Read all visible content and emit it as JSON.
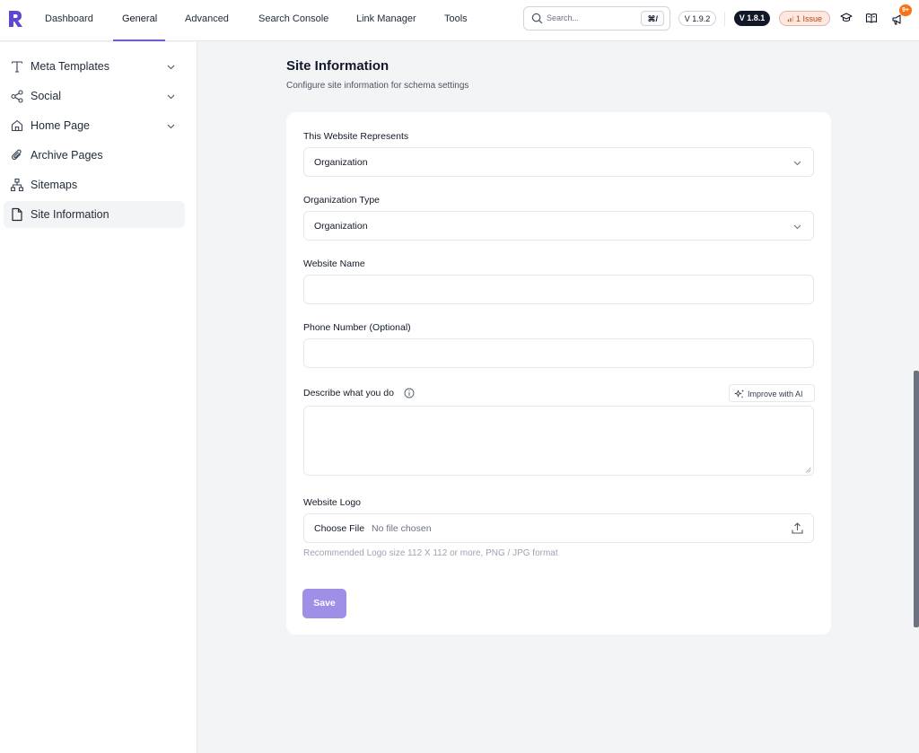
{
  "topnav": {
    "tabs": [
      {
        "label": "Dashboard"
      },
      {
        "label": "General",
        "active": true
      },
      {
        "label": "Advanced"
      },
      {
        "label": "Search Console"
      },
      {
        "label": "Link Manager"
      },
      {
        "label": "Tools"
      }
    ],
    "search": {
      "placeholder": "Search...",
      "shortcut": "⌘/"
    },
    "version_current": "V 1.9.2",
    "version_pro": "V 1.8.1",
    "issues": "1 Issue",
    "notification_count": "9+",
    "icons": [
      "academy-icon",
      "book-icon",
      "megaphone-icon"
    ]
  },
  "sidebar": {
    "items": [
      {
        "label": "Meta Templates",
        "icon": "text-icon",
        "expandable": true
      },
      {
        "label": "Social",
        "icon": "share-icon",
        "expandable": true
      },
      {
        "label": "Home Page",
        "icon": "home-icon",
        "expandable": true
      },
      {
        "label": "Archive Pages",
        "icon": "paperclip-icon",
        "expandable": false
      },
      {
        "label": "Sitemaps",
        "icon": "sitemap-icon",
        "expandable": false
      },
      {
        "label": "Site Information",
        "icon": "file-icon",
        "expandable": false,
        "active": true
      }
    ]
  },
  "main": {
    "title": "Site Information",
    "subtitle": "Configure site information for schema settings",
    "form": {
      "represents_label": "This Website Represents",
      "represents_value": "Organization",
      "org_type_label": "Organization Type",
      "org_type_value": "Organization",
      "website_name_label": "Website Name",
      "website_name_value": "",
      "phone_label": "Phone Number (Optional)",
      "phone_value": "",
      "describe_label": "Describe what you do",
      "improve_ai_label": "Improve with AI",
      "describe_value": "",
      "logo_label": "Website Logo",
      "choose_file_label": "Choose File",
      "no_file_label": "No file chosen",
      "logo_hint": "Recommended Logo size 112 X 112 or more, PNG / JPG format",
      "save_label": "Save"
    }
  },
  "colors": {
    "accent": "#6d5bd0",
    "save_button": "#9f8fe6",
    "issue_text": "#c2410c",
    "issue_bg": "#fde8e2",
    "badge": "#f97316"
  }
}
